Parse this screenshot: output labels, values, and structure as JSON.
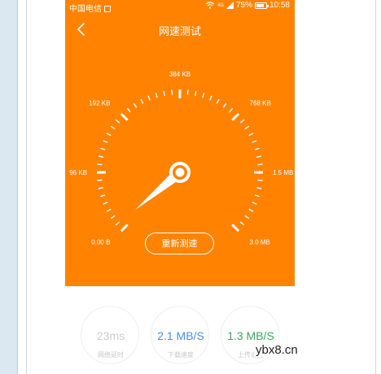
{
  "status_bar": {
    "carrier": "中国电信",
    "network": "4G",
    "battery": "75%",
    "time": "10:58"
  },
  "header": {
    "title": "网速测试"
  },
  "gauge": {
    "labels": [
      "0.00 B",
      "96 KB",
      "192 KB",
      "384 KB",
      "768 KB",
      "1.5 MB",
      "3.0 MB"
    ],
    "needle_fraction": 0.0
  },
  "retest_button": "重新测速",
  "stats": [
    {
      "value": "23ms",
      "label": "网络延时",
      "color": "#cccccc"
    },
    {
      "value": "2.1 MB/S",
      "label": "下载速度",
      "color": "#4a90e2"
    },
    {
      "value": "1.3 MB/S",
      "label": "上传速度",
      "color": "#3aa85c"
    }
  ],
  "watermark": "ybx8.cn",
  "colors": {
    "accent": "#ff8300"
  }
}
